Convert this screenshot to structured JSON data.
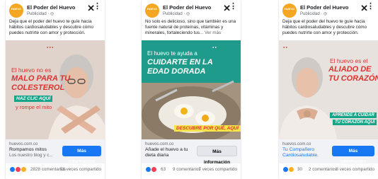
{
  "ads": [
    {
      "page_name": "El Poder del Huevo",
      "sponsored": "Publicidad",
      "logo_text": "HUEVO",
      "description": "Deja que el poder del huevo te guíe hacia hábitos cardiosaludables y descubre cómo puedes nutrirte con amor y protección.",
      "more": "",
      "image": {
        "line1": "El huevo no es",
        "line2": "MALO PARA TU",
        "line3": "COLESTEROL",
        "cta_text": "HAZ CLIC AQUÍ",
        "line4": "y rompe el mito"
      },
      "domain": "huevos.com.co",
      "link_title": "Rompamos mitos",
      "link_sub": "Los nuestro blog y c...",
      "cta": "Más información",
      "reaction_count": "28",
      "comments": "28 comentarios",
      "shares": "51 veces compartido"
    },
    {
      "page_name": "El Poder del Huevo",
      "sponsored": "Publicidad",
      "logo_text": "HUEVO",
      "description": "No solo es delicioso, sino que también es una fuente natural de proteínas, vitaminas y minerales, fortaleciendo tus",
      "more": "... Ver más",
      "image": {
        "line1": "El huevo te ayuda a",
        "line2": "CUIDARTE EN LA",
        "line3": "EDAD DORADA",
        "cta_text": "DESCUBRE POR QUÉ, AQUÍ"
      },
      "domain": "huevos.com.co",
      "link_title": "Añade el huevo a tu dieta diaria",
      "link_sub": "",
      "cta": "Más información",
      "reaction_count": "63",
      "comments": "9 comentarios",
      "shares": "7 veces compartido"
    },
    {
      "page_name": "El Poder del Huevo",
      "sponsored": "Publicidad",
      "logo_text": "HUEVO",
      "description": "Deja que el poder del huevo te guíe hacia hábitos cardiosaludables y descubre cómo puedes nutrirte con amor y protección.",
      "more": "",
      "image": {
        "line1": "El huevo es el",
        "line2": "ALIADO DE",
        "line3": "TU CORAZÓN",
        "cta_text": "APRENDE A CUIDAR",
        "cta_text2": "TU CORAZÓN AQUÍ"
      },
      "domain": "huevos.com.co",
      "link_title": "Tu Compañero Cardiosaludable.",
      "link_sub": "",
      "cta": "Más información",
      "reaction_count": "30",
      "comments": "2 comentarios",
      "shares": "8 veces compartido"
    }
  ],
  "colors": {
    "facebook_blue": "#1877f2",
    "like_blue": "#1877f2",
    "love_red": "#f33e58",
    "haha_yellow": "#f7b125",
    "ad1_bg": "#e7dcd6",
    "ad2_bg": "#1f9b8c",
    "ad3_bg": "#e6e0dc",
    "accent_red": "#e0312f",
    "accent_green": "#17a589"
  }
}
